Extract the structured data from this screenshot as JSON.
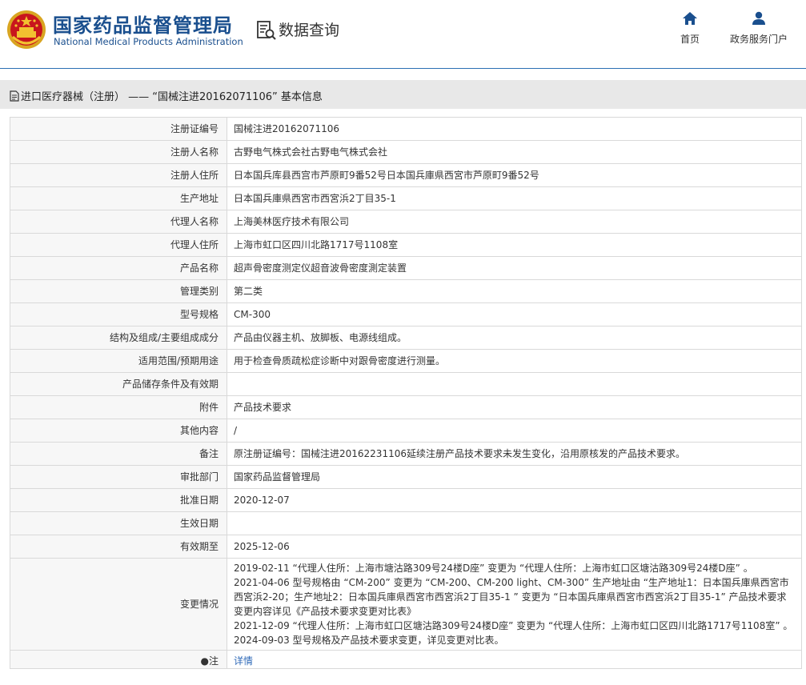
{
  "header": {
    "brand_cn": "国家药品监督管理局",
    "brand_en": "National Medical Products Administration",
    "query_title": "数据查询",
    "nav": [
      {
        "label": "首页",
        "icon": "home-icon"
      },
      {
        "label": "政务服务门户",
        "icon": "user-icon"
      }
    ],
    "accent_color": "#1a4f8e"
  },
  "breadcrumb": {
    "text": "进口医疗器械（注册） —— “国械注进20162071106” 基本信息",
    "icon": "document-icon"
  },
  "rows": [
    {
      "label": "注册证编号",
      "value": "国械注进20162071106"
    },
    {
      "label": "注册人名称",
      "value": "古野电气株式会社古野电气株式会社"
    },
    {
      "label": "注册人住所",
      "value": "日本国兵库县西宫市芦原町9番52号日本国兵庫県西宮市芦原町9番52号"
    },
    {
      "label": "生产地址",
      "value": "日本国兵庫県西宮市西宮浜2丁目35-1"
    },
    {
      "label": "代理人名称",
      "value": "上海美林医疗技术有限公司"
    },
    {
      "label": "代理人住所",
      "value": "上海市虹口区四川北路1717号1108室"
    },
    {
      "label": "产品名称",
      "value": "超声骨密度测定仪超音波骨密度測定装置"
    },
    {
      "label": "管理类别",
      "value": "第二类"
    },
    {
      "label": "型号规格",
      "value": "CM-300"
    },
    {
      "label": "结构及组成/主要组成成分",
      "value": "产品由仪器主机、放脚板、电源线组成。"
    },
    {
      "label": "适用范围/预期用途",
      "value": "用于检查骨质疏松症诊断中对跟骨密度进行测量。"
    },
    {
      "label": "产品储存条件及有效期",
      "value": ""
    },
    {
      "label": "附件",
      "value": "产品技术要求"
    },
    {
      "label": "其他内容",
      "value": "/"
    },
    {
      "label": "备注",
      "value": "原注册证编号：国械注进20162231106延续注册产品技术要求未发生变化，沿用原核发的产品技术要求。"
    },
    {
      "label": "审批部门",
      "value": "国家药品监督管理局"
    },
    {
      "label": "批准日期",
      "value": "2020-12-07"
    },
    {
      "label": "生效日期",
      "value": ""
    },
    {
      "label": "有效期至",
      "value": "2025-12-06"
    }
  ],
  "changes": {
    "label": "变更情况",
    "lines": [
      "2019-02-11 “代理人住所：上海市塘沽路309号24楼D座” 变更为 “代理人住所：上海市虹口区塘沽路309号24楼D座” 。",
      "2021-04-06 型号规格由 “CM-200” 变更为 “CM-200、CM-200 light、CM-300” 生产地址由 “生产地址1：日本国兵庫県西宮市西宮浜2-20；生产地址2：日本国兵庫県西宮市西宮浜2丁目35-1 ” 变更为 “日本国兵庫県西宮市西宮浜2丁目35-1” 产品技术要求变更内容详见《产品技术要求变更对比表》",
      "2021-12-09 “代理人住所：上海市虹口区塘沽路309号24楼D座” 变更为 “代理人住所：上海市虹口区四川北路1717号1108室” 。",
      "2024-09-03 型号规格及产品技术要求变更，详见变更对比表。"
    ]
  },
  "notes": {
    "label": "●注",
    "link": "详情"
  }
}
